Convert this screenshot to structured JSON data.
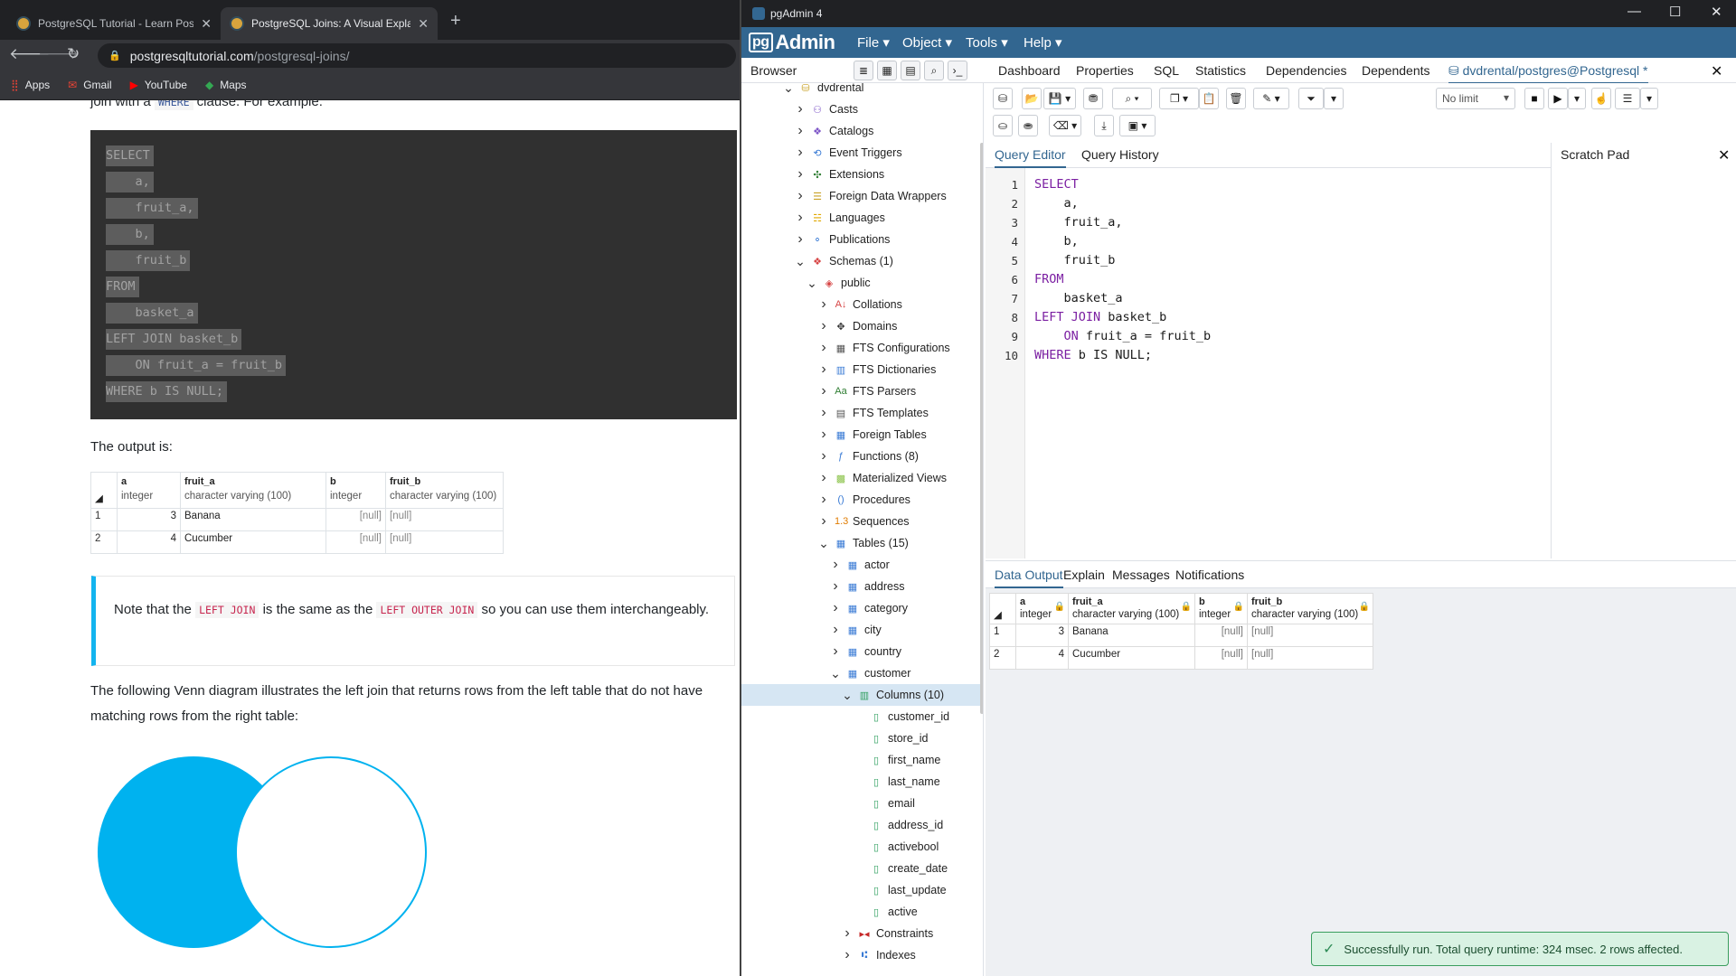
{
  "chrome": {
    "tabs": [
      {
        "title": "PostgreSQL Tutorial - Learn Postg"
      },
      {
        "title": "PostgreSQL Joins: A Visual Explan"
      }
    ],
    "url_host": "postgresqltutorial.com",
    "url_path": "/postgresql-joins/",
    "bookmarks": [
      "Apps",
      "Gmail",
      "YouTube",
      "Maps"
    ]
  },
  "article": {
    "intro_pre": "join with a",
    "intro_code": "WHERE",
    "intro_post": "clause. For example:",
    "code_lines": [
      "SELECT",
      "    a,",
      "    fruit_a,",
      "    b,",
      "    fruit_b",
      "FROM",
      "    basket_a",
      "LEFT JOIN basket_b",
      "    ON fruit_a = fruit_b",
      "WHERE b IS NULL;"
    ],
    "output_label": "The output is:",
    "table": {
      "columns": [
        {
          "name": "a",
          "type": "integer"
        },
        {
          "name": "fruit_a",
          "type": "character varying (100)"
        },
        {
          "name": "b",
          "type": "integer"
        },
        {
          "name": "fruit_b",
          "type": "character varying (100)"
        }
      ],
      "rows": [
        {
          "n": "1",
          "a": "3",
          "fruit_a": "Banana",
          "b": "[null]",
          "fruit_b": "[null]"
        },
        {
          "n": "2",
          "a": "4",
          "fruit_a": "Cucumber",
          "b": "[null]",
          "fruit_b": "[null]"
        }
      ]
    },
    "note_pre": "Note that the",
    "note_code1": "LEFT JOIN",
    "note_mid": "is the same as the",
    "note_code2": "LEFT OUTER JOIN",
    "note_post": "so you can use them interchangeably.",
    "venn_text": "The following Venn diagram illustrates the left join that returns rows from the left table that do not have matching rows from the right table:",
    "venn_color": "#00b2ef"
  },
  "pgadmin": {
    "window_title": "pgAdmin 4",
    "logo_pg": "pg",
    "logo_admin": "Admin",
    "menu": [
      "File",
      "Object",
      "Tools",
      "Help"
    ],
    "browser_label": "Browser",
    "panel_tabs": [
      "Dashboard",
      "Properties",
      "SQL",
      "Statistics",
      "Dependencies",
      "Dependents",
      "dvdrental/postgres@Postgresql *"
    ],
    "tree": [
      {
        "label": "dvdrental",
        "level": 0,
        "chev": "v",
        "icon": "db"
      },
      {
        "label": "Casts",
        "level": 1,
        "chev": ">",
        "icon": "cast"
      },
      {
        "label": "Catalogs",
        "level": 1,
        "chev": ">",
        "icon": "catalog"
      },
      {
        "label": "Event Triggers",
        "level": 1,
        "chev": ">",
        "icon": "event"
      },
      {
        "label": "Extensions",
        "level": 1,
        "chev": ">",
        "icon": "ext"
      },
      {
        "label": "Foreign Data Wrappers",
        "level": 1,
        "chev": ">",
        "icon": "fdw"
      },
      {
        "label": "Languages",
        "level": 1,
        "chev": ">",
        "icon": "lang"
      },
      {
        "label": "Publications",
        "level": 1,
        "chev": ">",
        "icon": "pub"
      },
      {
        "label": "Schemas (1)",
        "level": 1,
        "chev": "v",
        "icon": "schema"
      },
      {
        "label": "public",
        "level": 2,
        "chev": "v",
        "icon": "public"
      },
      {
        "label": "Collations",
        "level": 3,
        "chev": ">",
        "icon": "coll"
      },
      {
        "label": "Domains",
        "level": 3,
        "chev": ">",
        "icon": "domain"
      },
      {
        "label": "FTS Configurations",
        "level": 3,
        "chev": ">",
        "icon": "ftsc"
      },
      {
        "label": "FTS Dictionaries",
        "level": 3,
        "chev": ">",
        "icon": "ftsd"
      },
      {
        "label": "FTS Parsers",
        "level": 3,
        "chev": ">",
        "icon": "ftsp"
      },
      {
        "label": "FTS Templates",
        "level": 3,
        "chev": ">",
        "icon": "ftst"
      },
      {
        "label": "Foreign Tables",
        "level": 3,
        "chev": ">",
        "icon": "ftab"
      },
      {
        "label": "Functions (8)",
        "level": 3,
        "chev": ">",
        "icon": "func"
      },
      {
        "label": "Materialized Views",
        "level": 3,
        "chev": ">",
        "icon": "mview"
      },
      {
        "label": "Procedures",
        "level": 3,
        "chev": ">",
        "icon": "proc"
      },
      {
        "label": "Sequences",
        "level": 3,
        "chev": ">",
        "icon": "seq"
      },
      {
        "label": "Tables (15)",
        "level": 3,
        "chev": "v",
        "icon": "tables"
      },
      {
        "label": "actor",
        "level": 4,
        "chev": ">",
        "icon": "table"
      },
      {
        "label": "address",
        "level": 4,
        "chev": ">",
        "icon": "table"
      },
      {
        "label": "category",
        "level": 4,
        "chev": ">",
        "icon": "table"
      },
      {
        "label": "city",
        "level": 4,
        "chev": ">",
        "icon": "table"
      },
      {
        "label": "country",
        "level": 4,
        "chev": ">",
        "icon": "table"
      },
      {
        "label": "customer",
        "level": 4,
        "chev": "v",
        "icon": "table"
      },
      {
        "label": "Columns (10)",
        "level": 5,
        "chev": "v",
        "icon": "columns",
        "selected": true
      },
      {
        "label": "customer_id",
        "level": 6,
        "chev": "",
        "icon": "column"
      },
      {
        "label": "store_id",
        "level": 6,
        "chev": "",
        "icon": "column"
      },
      {
        "label": "first_name",
        "level": 6,
        "chev": "",
        "icon": "column"
      },
      {
        "label": "last_name",
        "level": 6,
        "chev": "",
        "icon": "column"
      },
      {
        "label": "email",
        "level": 6,
        "chev": "",
        "icon": "column"
      },
      {
        "label": "address_id",
        "level": 6,
        "chev": "",
        "icon": "column"
      },
      {
        "label": "activebool",
        "level": 6,
        "chev": "",
        "icon": "column"
      },
      {
        "label": "create_date",
        "level": 6,
        "chev": "",
        "icon": "column"
      },
      {
        "label": "last_update",
        "level": 6,
        "chev": "",
        "icon": "column"
      },
      {
        "label": "active",
        "level": 6,
        "chev": "",
        "icon": "column"
      },
      {
        "label": "Constraints",
        "level": 5,
        "chev": ">",
        "icon": "constr"
      },
      {
        "label": "Indexes",
        "level": 5,
        "chev": ">",
        "icon": "index"
      }
    ],
    "limit": "No limit",
    "query_tabs": [
      "Query Editor",
      "Query History"
    ],
    "scratch_pad": "Scratch Pad",
    "editor_lines": [
      {
        "n": "1",
        "kw": "SELECT",
        "rest": ""
      },
      {
        "n": "2",
        "kw": "",
        "rest": "    a,"
      },
      {
        "n": "3",
        "kw": "",
        "rest": "    fruit_a,"
      },
      {
        "n": "4",
        "kw": "",
        "rest": "    b,"
      },
      {
        "n": "5",
        "kw": "",
        "rest": "    fruit_b"
      },
      {
        "n": "6",
        "kw": "FROM",
        "rest": ""
      },
      {
        "n": "7",
        "kw": "",
        "rest": "    basket_a"
      },
      {
        "n": "8",
        "kw": "LEFT JOIN",
        "rest": " basket_b"
      },
      {
        "n": "9",
        "kw": "    ON",
        "rest": " fruit_a = fruit_b"
      },
      {
        "n": "10",
        "kw": "WHERE",
        "rest": " b IS NULL;"
      }
    ],
    "output_tabs": [
      "Data Output",
      "Explain",
      "Messages",
      "Notifications"
    ],
    "grid": {
      "columns": [
        {
          "name": "a",
          "type": "integer"
        },
        {
          "name": "fruit_a",
          "type": "character varying (100)"
        },
        {
          "name": "b",
          "type": "integer"
        },
        {
          "name": "fruit_b",
          "type": "character varying (100)"
        }
      ],
      "rows": [
        {
          "n": "1",
          "a": "3",
          "fruit_a": "Banana",
          "b": "[null]",
          "fruit_b": "[null]"
        },
        {
          "n": "2",
          "a": "4",
          "fruit_a": "Cucumber",
          "b": "[null]",
          "fruit_b": "[null]"
        }
      ]
    },
    "toast": "Successfully run. Total query runtime: 324 msec. 2 rows affected."
  }
}
